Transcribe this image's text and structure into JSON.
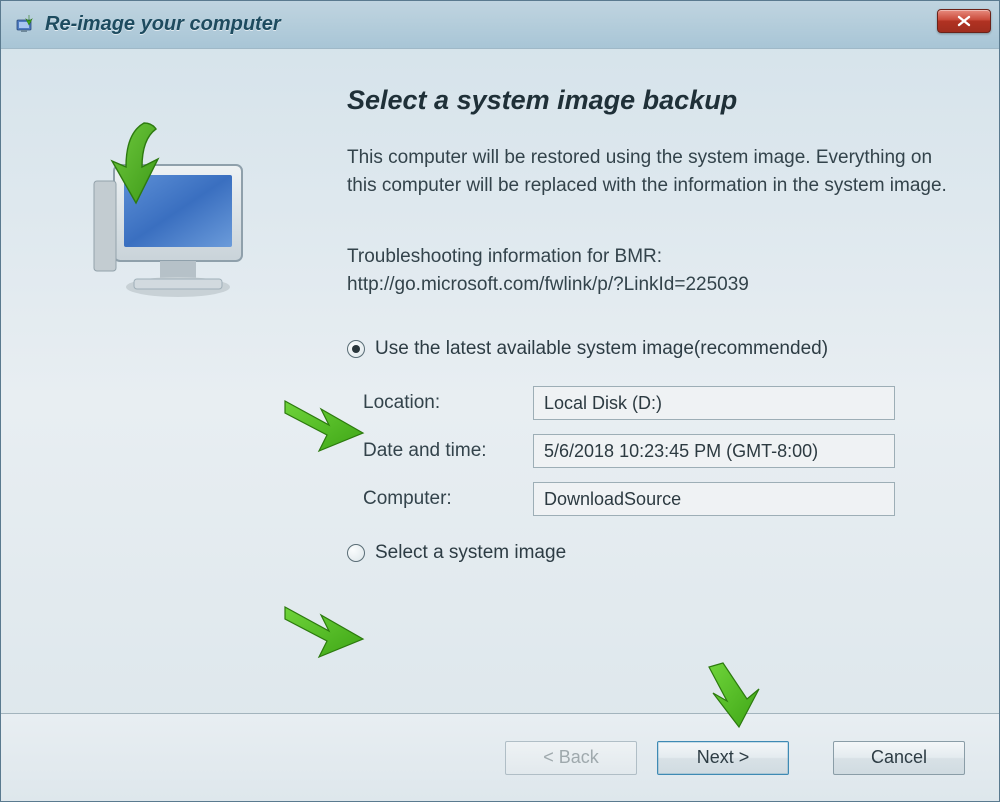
{
  "titlebar": {
    "title": "Re-image your computer"
  },
  "main": {
    "heading": "Select a system image backup",
    "description": "This computer will be restored using the system image. Everything on this computer will be replaced with the information in the system image.",
    "troubleshoot_line1": "Troubleshooting information for BMR:",
    "troubleshoot_line2": "http://go.microsoft.com/fwlink/p/?LinkId=225039",
    "radio1_label": "Use the latest available system image(recommended)",
    "radio2_label": "Select a system image",
    "fields": {
      "location_label": "Location:",
      "location_value": "Local Disk (D:)",
      "datetime_label": "Date and time:",
      "datetime_value": "5/6/2018 10:23:45 PM (GMT-8:00)",
      "computer_label": "Computer:",
      "computer_value": "DownloadSource"
    }
  },
  "footer": {
    "back": "< Back",
    "next": "Next >",
    "cancel": "Cancel"
  }
}
